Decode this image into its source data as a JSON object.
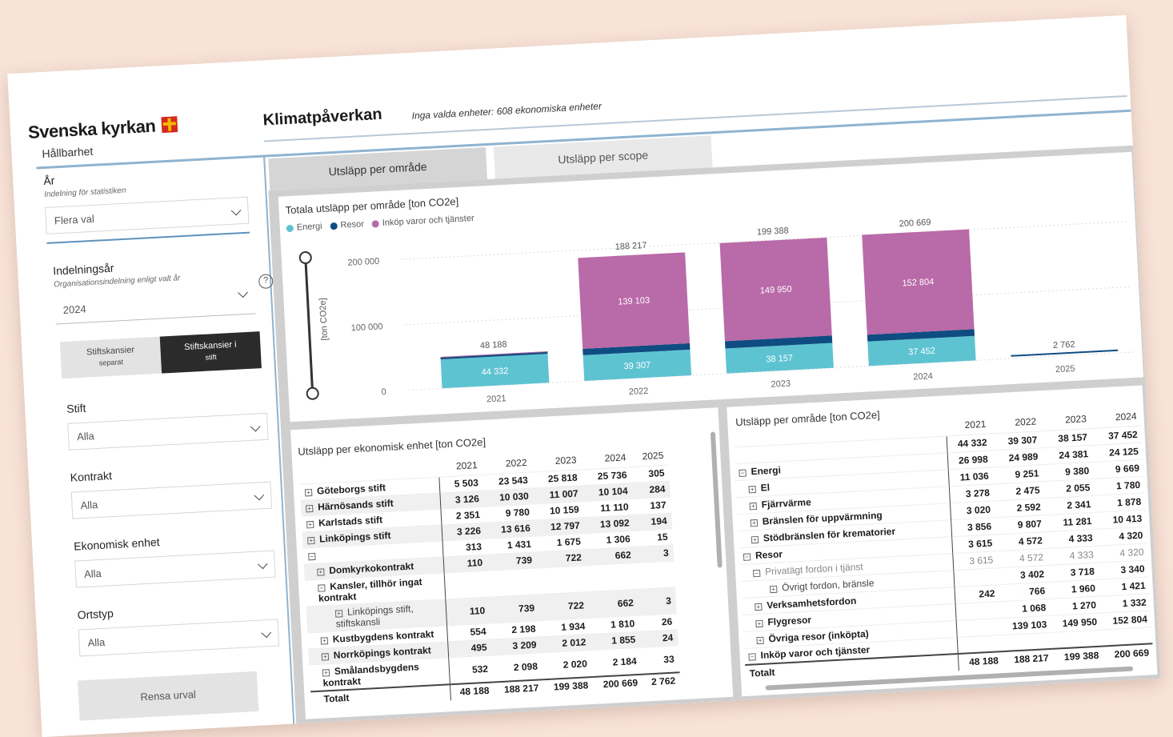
{
  "brand": {
    "name": "Svenska kyrkan",
    "subtitle": "Hållbarhet",
    "accent_red": "#d52b1e",
    "accent_yellow": "#f5b700"
  },
  "header": {
    "title": "Klimatpåverkan",
    "selection_info": "Inga valda enheter: 608 ekonomiska enheter"
  },
  "sidebar": {
    "year": {
      "title": "År",
      "subtitle": "Indelning för statistiken",
      "value": "Flera val"
    },
    "division_year": {
      "title": "Indelningsår",
      "subtitle": "Organisationsindelning enligt valt år",
      "value": "2024",
      "help_icon": "question-circle-icon"
    },
    "toggle": {
      "left_line1": "Stiftskansier",
      "left_line2": "separat",
      "right_line1": "Stiftskansier i",
      "right_line2": "stift"
    },
    "diocese": {
      "title": "Stift",
      "value": "Alla"
    },
    "contract": {
      "title": "Kontrakt",
      "value": "Alla"
    },
    "economic_unit": {
      "title": "Ekonomisk enhet",
      "value": "Alla"
    },
    "place_type": {
      "title": "Ortstyp",
      "value": "Alla"
    },
    "clear_button": "Rensa urval"
  },
  "tabs": [
    {
      "label": "Utsläpp per område"
    },
    {
      "label": "Utsläpp per scope"
    }
  ],
  "chart_data": {
    "type": "bar",
    "title": "Totala utsläpp per område [ton CO2e]",
    "ylabel": "[ton CO2e]",
    "categories": [
      "2021",
      "2022",
      "2023",
      "2024",
      "2025"
    ],
    "yticks": [
      "0",
      "100 000",
      "200 000"
    ],
    "ylim": [
      0,
      230000
    ],
    "series": [
      {
        "name": "Energi",
        "color": "#5ec3d1",
        "values": [
          44332,
          39307,
          38157,
          37452,
          0
        ]
      },
      {
        "name": "Resor",
        "color": "#0f4c81",
        "values": [
          3615,
          9807,
          11281,
          10413,
          0
        ]
      },
      {
        "name": "Inköp varor och tjänster",
        "color": "#b96aa8",
        "values": [
          241,
          139103,
          149950,
          152804,
          0
        ]
      }
    ],
    "segment_labels": [
      [
        "44 332",
        "",
        ""
      ],
      [
        "39 307",
        "",
        "139 103"
      ],
      [
        "38 157",
        "",
        "149 950"
      ],
      [
        "37 452",
        "",
        "152 804"
      ],
      [
        "",
        "",
        ""
      ]
    ],
    "totals": [
      48188,
      188217,
      199388,
      200669,
      2762
    ],
    "total_labels": [
      "48 188",
      "188 217",
      "199 388",
      "200 669",
      "2 762"
    ]
  },
  "unit_table": {
    "title": "Utsläpp per ekonomisk enhet [ton CO2e]",
    "columns": [
      "2021",
      "2022",
      "2023",
      "2024",
      "2025"
    ],
    "rows": [
      {
        "label": "Göteborgs stift",
        "level": 0,
        "exp": "+",
        "values": [
          "5 503",
          "23 543",
          "25 818",
          "25 736",
          "305"
        ]
      },
      {
        "label": "Härnösands stift",
        "level": 0,
        "exp": "+",
        "values": [
          "3 126",
          "10 030",
          "11 007",
          "10 104",
          "284"
        ]
      },
      {
        "label": "Karlstads stift",
        "level": 0,
        "exp": "+",
        "values": [
          "2 351",
          "9 780",
          "10 159",
          "11 110",
          "137"
        ]
      },
      {
        "label": "Linköpings stift",
        "level": 0,
        "exp": "+",
        "values": [
          "3 226",
          "13 616",
          "12 797",
          "13 092",
          "194"
        ]
      },
      {
        "label": "",
        "level": 0,
        "exp": "−",
        "values": [
          "313",
          "1 431",
          "1 675",
          "1 306",
          "15"
        ]
      },
      {
        "label": "Domkyrkokontrakt",
        "level": 1,
        "exp": "+",
        "values": [
          "110",
          "739",
          "722",
          "662",
          "3"
        ]
      },
      {
        "label": "Kansler, tillhör ingat kontrakt",
        "level": 1,
        "exp": "−",
        "values": [
          "",
          "",
          "",
          "",
          ""
        ]
      },
      {
        "label": "Linköpings stift, stiftskansli",
        "level": 2,
        "exp": "+",
        "values": [
          "110",
          "739",
          "722",
          "662",
          "3"
        ]
      },
      {
        "label": "Kustbygdens kontrakt",
        "level": 1,
        "exp": "+",
        "values": [
          "554",
          "2 198",
          "1 934",
          "1 810",
          "26"
        ]
      },
      {
        "label": "Norrköpings kontrakt",
        "level": 1,
        "exp": "+",
        "values": [
          "495",
          "3 209",
          "2 012",
          "1 855",
          "24"
        ]
      },
      {
        "label": "Smålandsbygdens kontrakt",
        "level": 1,
        "exp": "+",
        "values": [
          "532",
          "2 098",
          "2 020",
          "2 184",
          "33"
        ]
      }
    ],
    "total": {
      "label": "Totalt",
      "values": [
        "48 188",
        "188 217",
        "199 388",
        "200 669",
        "2 762"
      ]
    }
  },
  "area_table": {
    "title": "Utsläpp per område [ton CO2e]",
    "columns": [
      "2021",
      "2022",
      "2023",
      "2024"
    ],
    "rows": [
      {
        "label": "",
        "level": 0,
        "exp": "",
        "dim": false,
        "values": [
          "44 332",
          "39 307",
          "38 157",
          "37 452"
        ]
      },
      {
        "label": "Energi",
        "level": 0,
        "exp": "−",
        "dim": false,
        "values": [
          "26 998",
          "24 989",
          "24 381",
          "24 125"
        ]
      },
      {
        "label": "El",
        "level": 1,
        "exp": "+",
        "dim": false,
        "values": [
          "11 036",
          "9 251",
          "9 380",
          "9 669"
        ]
      },
      {
        "label": "Fjärrvärme",
        "level": 1,
        "exp": "+",
        "dim": false,
        "values": [
          "3 278",
          "2 475",
          "2 055",
          "1 780"
        ]
      },
      {
        "label": "Bränslen för uppvärmning",
        "level": 1,
        "exp": "+",
        "dim": false,
        "values": [
          "3 020",
          "2 592",
          "2 341",
          "1 878"
        ]
      },
      {
        "label": "Stödbränslen för krematorier",
        "level": 1,
        "exp": "+",
        "dim": false,
        "values": [
          "3 856",
          "9 807",
          "11 281",
          "10 413"
        ]
      },
      {
        "label": "Resor",
        "level": 0,
        "exp": "−",
        "dim": false,
        "values": [
          "3 615",
          "4 572",
          "4 333",
          "4 320"
        ]
      },
      {
        "label": "Privatägt fordon i tjänst",
        "level": 1,
        "exp": "−",
        "dim": true,
        "values": [
          "3 615",
          "4 572",
          "4 333",
          "4 320"
        ]
      },
      {
        "label": "Övrigt fordon, bränsle",
        "level": 2,
        "exp": "+",
        "dim": false,
        "values": [
          "",
          "3 402",
          "3 718",
          "3 340"
        ]
      },
      {
        "label": "Verksamhetsfordon",
        "level": 1,
        "exp": "+",
        "dim": false,
        "values": [
          "242",
          "766",
          "1 960",
          "1 421"
        ]
      },
      {
        "label": "Flygresor",
        "level": 1,
        "exp": "+",
        "dim": false,
        "values": [
          "",
          "1 068",
          "1 270",
          "1 332"
        ]
      },
      {
        "label": "Övriga resor (inköpta)",
        "level": 1,
        "exp": "+",
        "dim": false,
        "values": [
          "",
          "139 103",
          "149 950",
          "152 804"
        ]
      },
      {
        "label": "Inköp varor och tjänster",
        "level": 0,
        "exp": "−",
        "dim": false,
        "values": [
          "",
          "",
          "",
          ""
        ]
      }
    ],
    "total": {
      "label": "Totalt",
      "values": [
        "48 188",
        "188 217",
        "199 388",
        "200 669"
      ]
    }
  }
}
